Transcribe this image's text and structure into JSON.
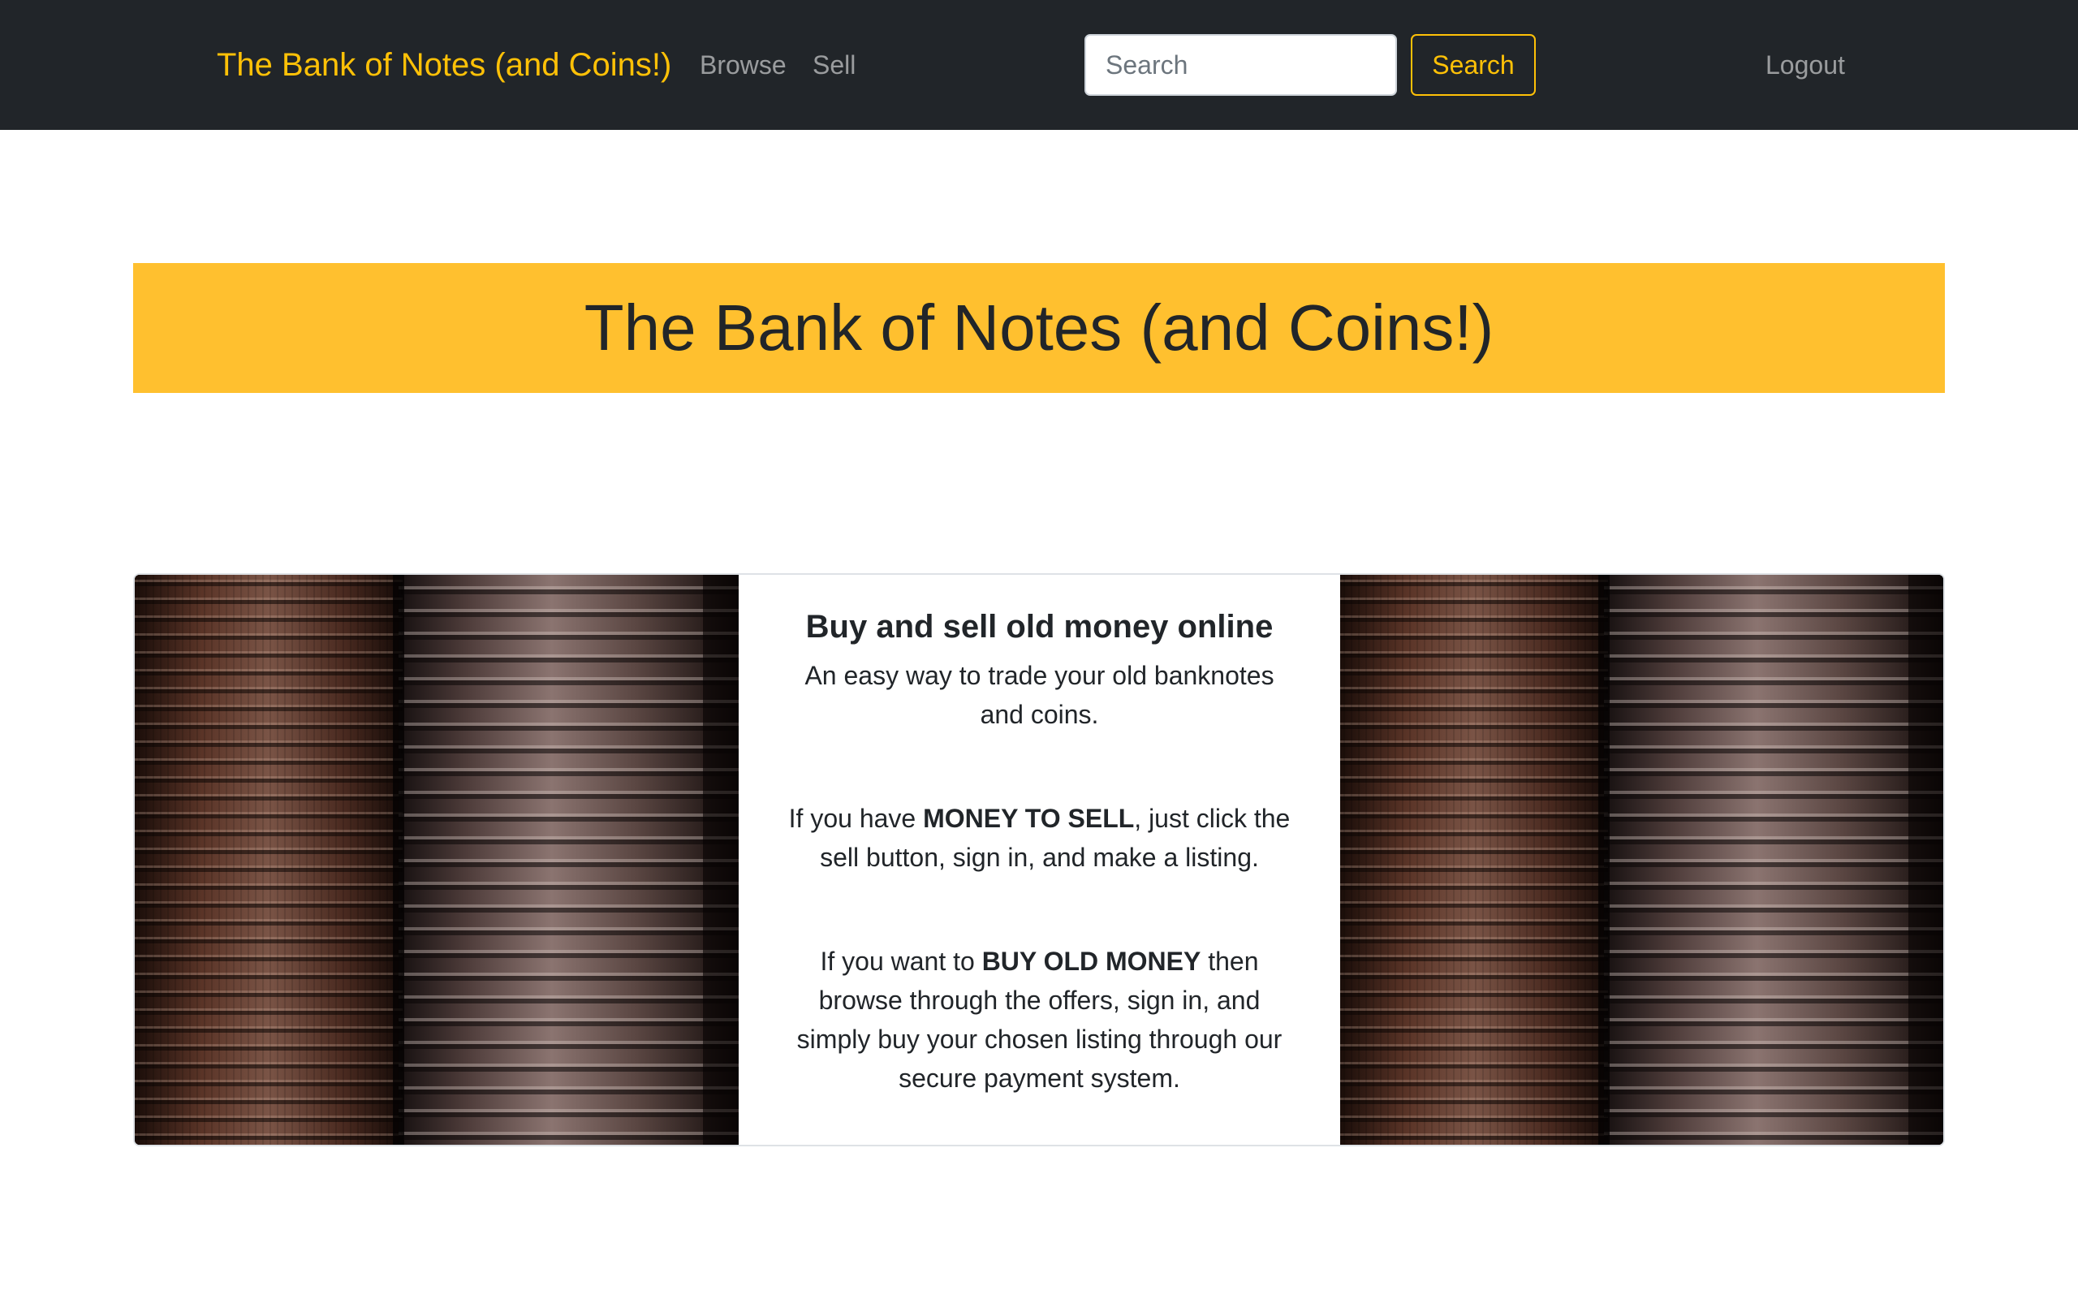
{
  "navbar": {
    "brand": "The Bank of Notes (and Coins!)",
    "links": {
      "browse": "Browse",
      "sell": "Sell",
      "logout": "Logout"
    },
    "search": {
      "placeholder": "Search",
      "value": "",
      "button_label": "Search"
    }
  },
  "hero": {
    "title": "The Bank of Notes (and Coins!)"
  },
  "feature": {
    "heading": "Buy and sell old money online",
    "intro": "An easy way to trade your old banknotes and coins.",
    "sell_para": {
      "before": "If you have ",
      "emphasis": "MONEY TO SELL",
      "after": ", just click the sell button, sign in, and make a listing."
    },
    "buy_para": {
      "before": "If you want to ",
      "emphasis": "BUY OLD MONEY",
      "after": " then browse through the offers, sign in, and simply buy your chosen listing through our secure payment system."
    }
  },
  "colors": {
    "navbar_bg": "#212529",
    "accent": "#ffc107",
    "hero_bg": "#ffc02f",
    "text": "#212529"
  }
}
